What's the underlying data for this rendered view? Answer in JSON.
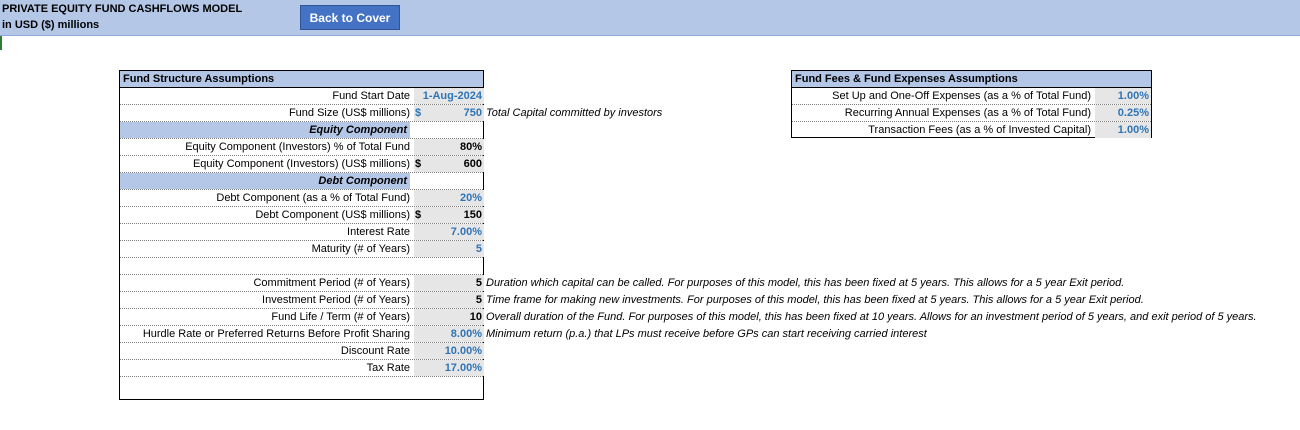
{
  "header": {
    "title": "PRIVATE EQUITY FUND CASHFLOWS MODEL",
    "subtitle": "in USD ($) millions",
    "back_button": "Back to Cover"
  },
  "fund_structure": {
    "heading": "Fund Structure Assumptions",
    "fund_start_date": {
      "label": "Fund Start Date",
      "value": "1-Aug-2024"
    },
    "fund_size": {
      "label": "Fund Size (US$ millions)",
      "currency": "$",
      "value": "750",
      "note": "Total Capital committed by investors"
    },
    "equity_section": "Equity Component",
    "equity_pct": {
      "label": "Equity Component (Investors) % of Total Fund",
      "value": "80%"
    },
    "equity_amount": {
      "label": "Equity Component (Investors) (US$ millions)",
      "currency": "$",
      "value": "600"
    },
    "debt_section": "Debt Component",
    "debt_pct": {
      "label": "Debt Component (as a % of Total Fund)",
      "value": "20%"
    },
    "debt_amount": {
      "label": "Debt Component (US$ millions)",
      "currency": "$",
      "value": "150"
    },
    "interest_rate": {
      "label": "Interest Rate",
      "value": "7.00%"
    },
    "maturity": {
      "label": "Maturity (# of Years)",
      "value": "5"
    },
    "commitment_period": {
      "label": "Commitment Period (# of Years)",
      "value": "5",
      "note": "Duration which capital can be called. For purposes of this model, this has been fixed at 5 years. This allows for a 5 year Exit period."
    },
    "investment_period": {
      "label": "Investment Period (# of Years)",
      "value": "5",
      "note": "Time frame for making new investments. For purposes of this model, this has been fixed at 5 years. This allows for a 5 year Exit period."
    },
    "fund_life": {
      "label": "Fund Life / Term (# of Years)",
      "value": "10",
      "note": "Overall duration of the Fund. For purposes of this model, this has been fixed at 10 years. Allows for an investment period of 5 years, and exit period of 5 years."
    },
    "hurdle_rate": {
      "label": "Hurdle Rate or Preferred Returns Before Profit Sharing",
      "value": "8.00%",
      "note": "Minimum return (p.a.) that LPs must receive before GPs can start receiving carried interest"
    },
    "discount_rate": {
      "label": "Discount Rate",
      "value": "10.00%"
    },
    "tax_rate": {
      "label": "Tax Rate",
      "value": "17.00%"
    }
  },
  "fund_fees": {
    "heading": "Fund Fees & Fund Expenses Assumptions",
    "setup_expenses": {
      "label": "Set Up and One-Off Expenses (as a % of Total Fund)",
      "value": "1.00%"
    },
    "recurring_expenses": {
      "label": "Recurring Annual Expenses (as a % of Total Fund)",
      "value": "0.25%"
    },
    "transaction_fees": {
      "label": "Transaction Fees (as a % of Invested Capital)",
      "value": "1.00%"
    }
  },
  "colors": {
    "header_band": "#b4c7e7",
    "button": "#4472c4",
    "input_blue": "#2e75b6",
    "cell_grey": "#e7e6e6"
  }
}
